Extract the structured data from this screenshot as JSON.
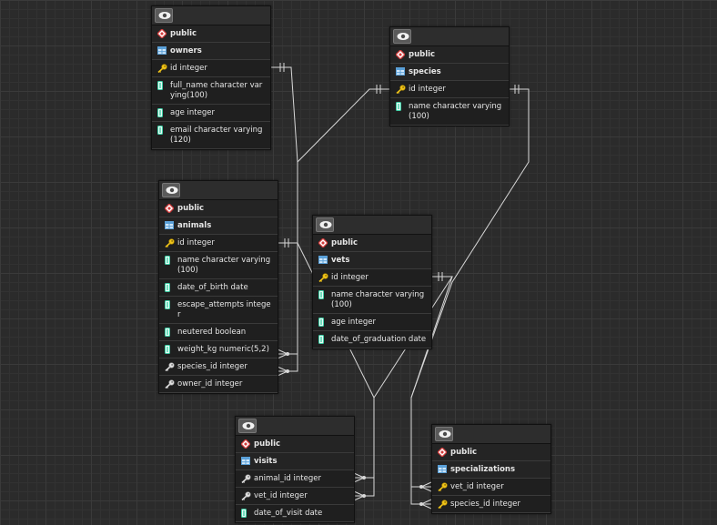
{
  "tables": [
    {
      "id": "owners",
      "schema": "public",
      "name": "owners",
      "columns": [
        {
          "kind": "pk",
          "text": "id integer"
        },
        {
          "kind": "col",
          "text": "full_name character varying(100)"
        },
        {
          "kind": "col",
          "text": "age integer"
        },
        {
          "kind": "col",
          "text": "email character varying(120)"
        }
      ]
    },
    {
      "id": "species",
      "schema": "public",
      "name": "species",
      "columns": [
        {
          "kind": "pk",
          "text": "id integer"
        },
        {
          "kind": "col",
          "text": "name character varying(100)"
        }
      ]
    },
    {
      "id": "animals",
      "schema": "public",
      "name": "animals",
      "columns": [
        {
          "kind": "pk",
          "text": "id integer"
        },
        {
          "kind": "col",
          "text": "name character varying(100)"
        },
        {
          "kind": "col",
          "text": "date_of_birth date"
        },
        {
          "kind": "col",
          "text": "escape_attempts integer"
        },
        {
          "kind": "col",
          "text": "neutered boolean"
        },
        {
          "kind": "col",
          "text": "weight_kg numeric(5,2)"
        },
        {
          "kind": "fk",
          "text": "species_id integer"
        },
        {
          "kind": "fk",
          "text": "owner_id integer"
        }
      ]
    },
    {
      "id": "vets",
      "schema": "public",
      "name": "vets",
      "columns": [
        {
          "kind": "pk",
          "text": "id integer"
        },
        {
          "kind": "col",
          "text": "name character varying(100)"
        },
        {
          "kind": "col",
          "text": "age integer"
        },
        {
          "kind": "col",
          "text": "date_of_graduation date"
        }
      ]
    },
    {
      "id": "visits",
      "schema": "public",
      "name": "visits",
      "columns": [
        {
          "kind": "fk",
          "text": "animal_id integer"
        },
        {
          "kind": "fk",
          "text": "vet_id integer"
        },
        {
          "kind": "col",
          "text": "date_of_visit date"
        }
      ]
    },
    {
      "id": "specializations",
      "schema": "public",
      "name": "specializations",
      "columns": [
        {
          "kind": "pk",
          "text": "vet_id integer"
        },
        {
          "kind": "pk",
          "text": "species_id integer"
        }
      ]
    }
  ]
}
